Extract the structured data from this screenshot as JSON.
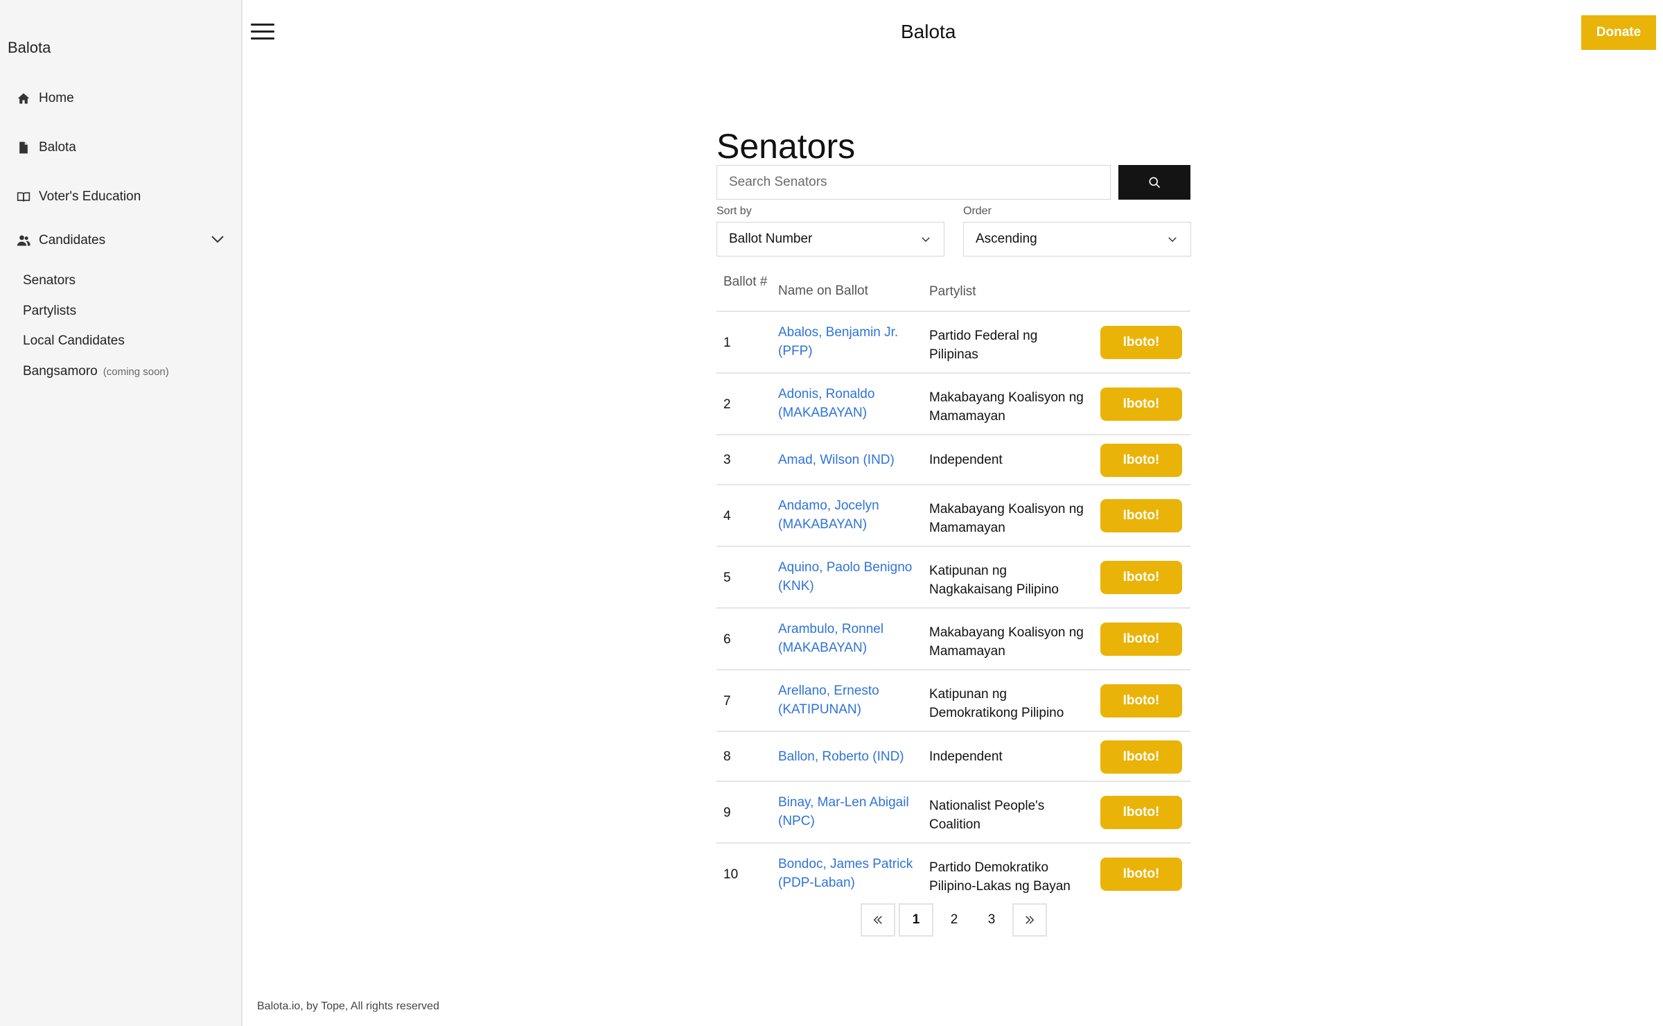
{
  "sidebar": {
    "brand": "Balota",
    "nav": [
      {
        "label": "Home",
        "icon": "home-icon"
      },
      {
        "label": "Balota",
        "icon": "file-icon"
      },
      {
        "label": "Voter's Education",
        "icon": "book-icon"
      },
      {
        "label": "Candidates",
        "icon": "users-icon"
      }
    ],
    "candidates_sub": [
      {
        "label": "Senators"
      },
      {
        "label": "Partylists"
      },
      {
        "label": "Local Candidates"
      },
      {
        "label": "Bangsamoro",
        "note": "(coming soon)"
      }
    ]
  },
  "header": {
    "title": "Balota",
    "donate_label": "Donate"
  },
  "main": {
    "title": "Senators",
    "search_placeholder": "Search Senators",
    "sort_by": {
      "label": "Sort by",
      "value": "Ballot Number"
    },
    "order": {
      "label": "Order",
      "value": "Ascending"
    },
    "columns": [
      "Ballot #",
      "Name on Ballot",
      "Partylist"
    ],
    "rows": [
      {
        "num": "1",
        "name": "Abalos, Benjamin Jr. (PFP)",
        "party": "Partido Federal ng Pilipinas",
        "action": "Iboto!"
      },
      {
        "num": "2",
        "name": "Adonis, Ronaldo (MAKABAYAN)",
        "party": "Makabayang Koalisyon ng Mamamayan",
        "action": "Iboto!"
      },
      {
        "num": "3",
        "name": "Amad, Wilson (IND)",
        "party": "Independent",
        "action": "Iboto!"
      },
      {
        "num": "4",
        "name": "Andamo, Jocelyn (MAKABAYAN)",
        "party": "Makabayang Koalisyon ng Mamamayan",
        "action": "Iboto!"
      },
      {
        "num": "5",
        "name": "Aquino, Paolo Benigno (KNK)",
        "party": "Katipunan ng Nagkakaisang Pilipino",
        "action": "Iboto!"
      },
      {
        "num": "6",
        "name": "Arambulo, Ronnel (MAKABAYAN)",
        "party": "Makabayang Koalisyon ng Mamamayan",
        "action": "Iboto!"
      },
      {
        "num": "7",
        "name": "Arellano, Ernesto (KATIPUNAN)",
        "party": "Katipunan ng Demokratikong Pilipino",
        "action": "Iboto!"
      },
      {
        "num": "8",
        "name": "Ballon, Roberto (IND)",
        "party": "Independent",
        "action": "Iboto!"
      },
      {
        "num": "9",
        "name": "Binay, Mar-Len Abigail (NPC)",
        "party": "Nationalist People's Coalition",
        "action": "Iboto!"
      },
      {
        "num": "10",
        "name": "Bondoc, James Patrick (PDP-Laban)",
        "party": "Partido Demokratiko Pilipino-Lakas ng Bayan",
        "action": "Iboto!"
      }
    ],
    "pagination": {
      "pages": [
        "1",
        "2",
        "3"
      ],
      "current": "1",
      "prev_icon": "double-chevron-left-icon",
      "next_icon": "double-chevron-right-icon"
    }
  },
  "footer": {
    "text": "Balota.io, by Tope, All rights reserved"
  },
  "colors": {
    "accent": "#eab308",
    "link": "#2f73da",
    "search_button": "#141414",
    "sidebar_bg": "#f5f5f5"
  }
}
